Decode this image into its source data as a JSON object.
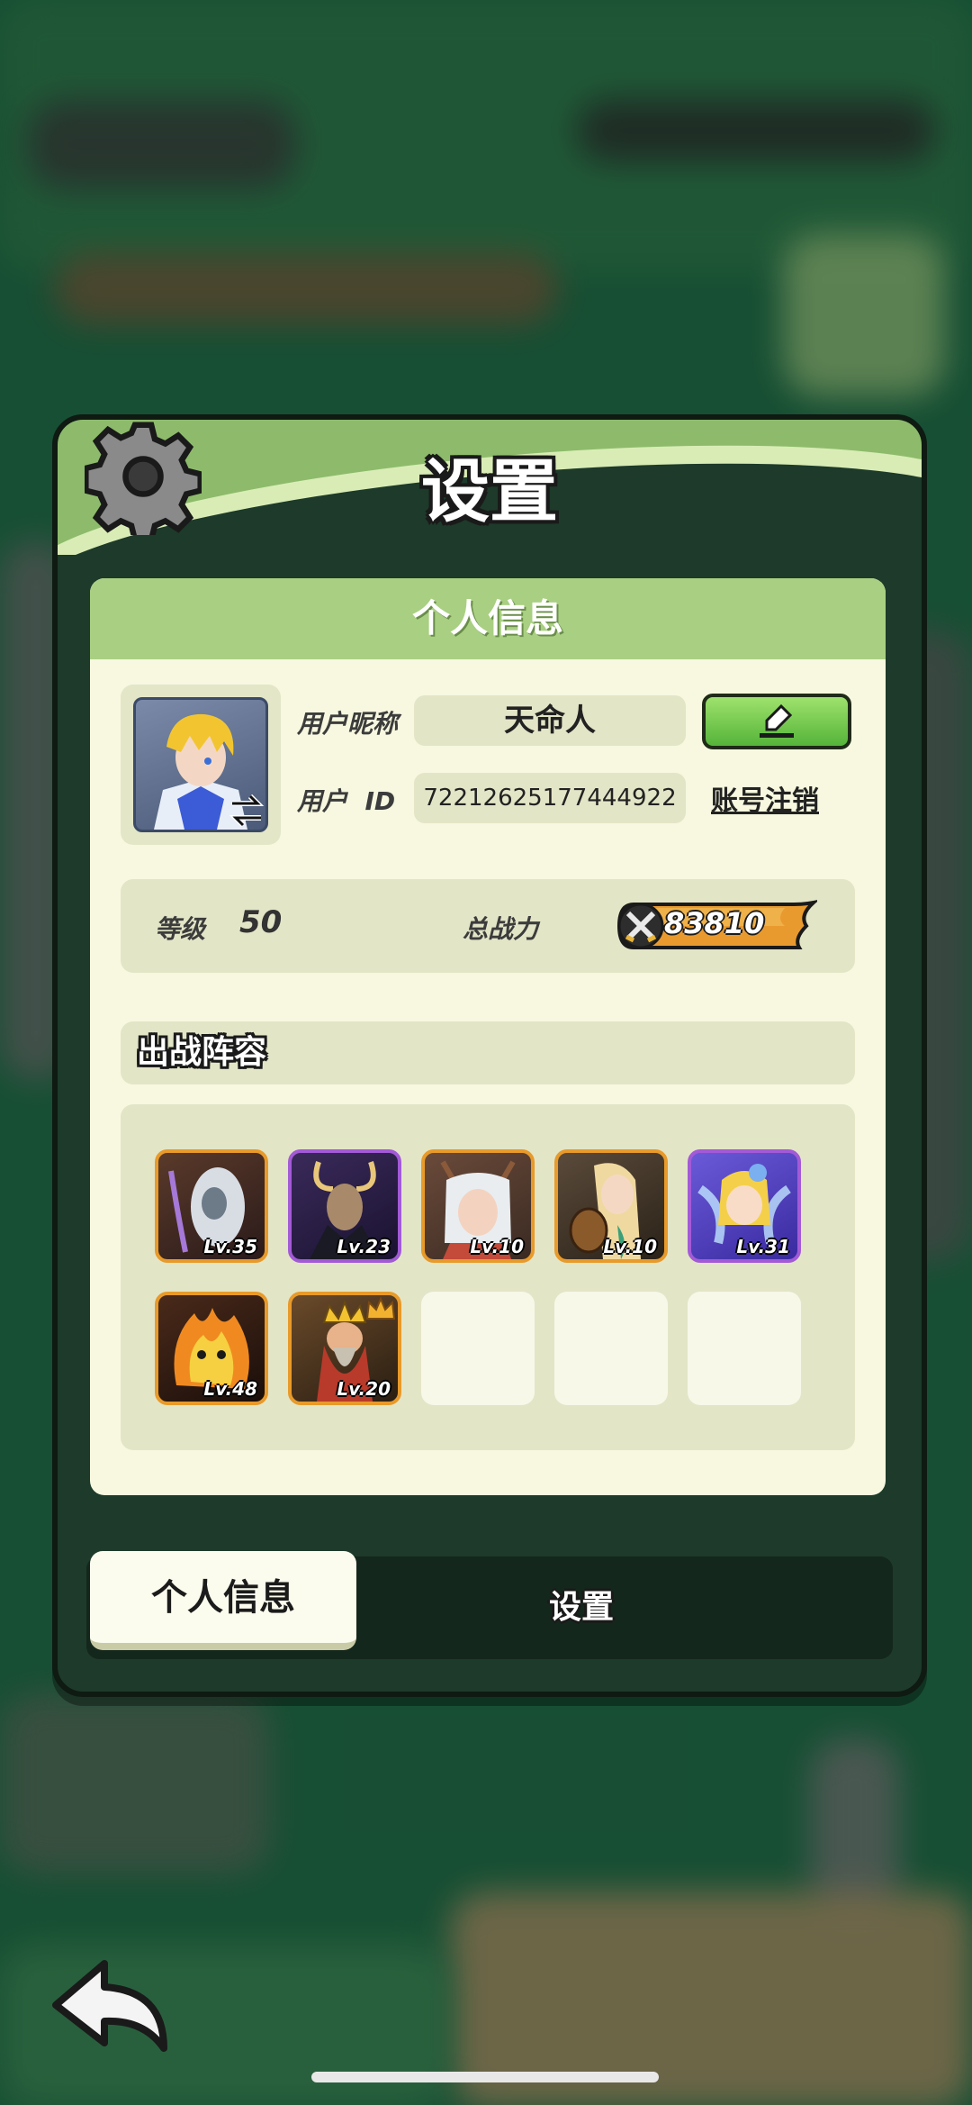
{
  "header": {
    "title": "设置"
  },
  "personal_info": {
    "section_title": "个人信息",
    "nickname_label": "用户昵称",
    "nickname": "天命人",
    "id_label": "用户  ID",
    "user_id": "72212625177444922",
    "logout_label": "账号注销",
    "level_label": "等级",
    "level": "50",
    "power_label": "总战力",
    "power": "83810"
  },
  "lineup": {
    "title": "出战阵容",
    "heroes": [
      {
        "level": "Lv.35",
        "rarity": "orange",
        "art": "ghost-witch"
      },
      {
        "level": "Lv.23",
        "rarity": "purple",
        "art": "goat-demon"
      },
      {
        "level": "Lv.10",
        "rarity": "orange",
        "art": "antler-girl"
      },
      {
        "level": "Lv.10",
        "rarity": "orange",
        "art": "bard-girl"
      },
      {
        "level": "Lv.31",
        "rarity": "purple",
        "art": "fairy"
      },
      {
        "level": "Lv.48",
        "rarity": "orange",
        "art": "fire-demon"
      },
      {
        "level": "Lv.20",
        "rarity": "orange",
        "art": "dwarf-king"
      }
    ],
    "empty_slots": 3
  },
  "tabs": {
    "active": "个人信息",
    "inactive": "设置"
  },
  "colors": {
    "panel_green": "#8dbb6b",
    "card_bg": "#f7f8df",
    "field_bg": "#e3e5c7",
    "edit_green": "#55b43a",
    "rarity_orange": "#e89a2a",
    "rarity_purple": "#a35ad6"
  }
}
